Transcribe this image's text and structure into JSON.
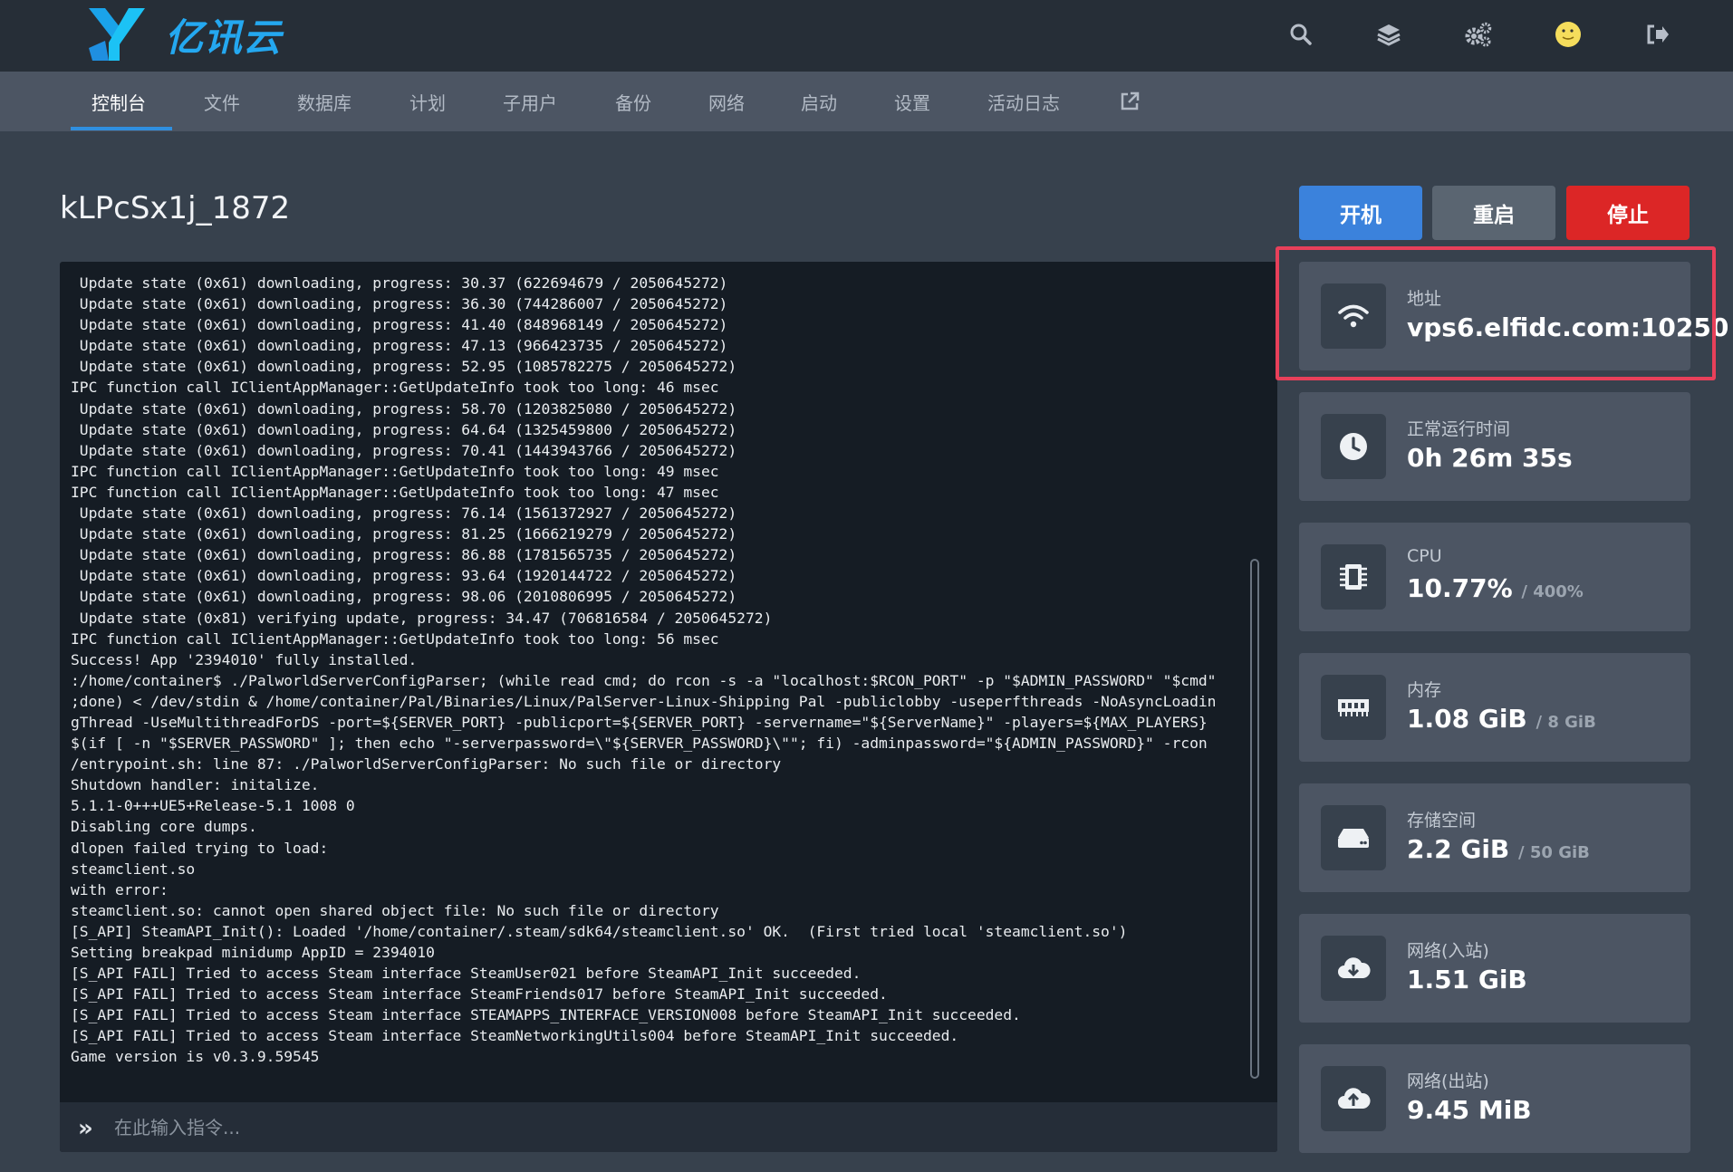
{
  "brand": {
    "name": "亿讯云"
  },
  "top_icons": [
    "search-icon",
    "layers-icon",
    "cogs-icon",
    "avatar",
    "sign-out-icon"
  ],
  "nav": {
    "tabs": [
      {
        "label": "控制台"
      },
      {
        "label": "文件"
      },
      {
        "label": "数据库"
      },
      {
        "label": "计划"
      },
      {
        "label": "子用户"
      },
      {
        "label": "备份"
      },
      {
        "label": "网络"
      },
      {
        "label": "启动"
      },
      {
        "label": "设置"
      },
      {
        "label": "活动日志"
      }
    ],
    "active_tab": "控制台",
    "external_link_icon": "external-link-icon"
  },
  "server": {
    "name": "kLPcSx1j_1872"
  },
  "power": {
    "start_label": "开机",
    "restart_label": "重启",
    "stop_label": "停止"
  },
  "console": {
    "lines": [
      " Update state (0x61) downloading, progress: 30.37 (622694679 / 2050645272)",
      " Update state (0x61) downloading, progress: 36.30 (744286007 / 2050645272)",
      " Update state (0x61) downloading, progress: 41.40 (848968149 / 2050645272)",
      " Update state (0x61) downloading, progress: 47.13 (966423735 / 2050645272)",
      " Update state (0x61) downloading, progress: 52.95 (1085782275 / 2050645272)",
      "IPC function call IClientAppManager::GetUpdateInfo took too long: 46 msec",
      " Update state (0x61) downloading, progress: 58.70 (1203825080 / 2050645272)",
      " Update state (0x61) downloading, progress: 64.64 (1325459800 / 2050645272)",
      " Update state (0x61) downloading, progress: 70.41 (1443943766 / 2050645272)",
      "IPC function call IClientAppManager::GetUpdateInfo took too long: 49 msec",
      "IPC function call IClientAppManager::GetUpdateInfo took too long: 47 msec",
      " Update state (0x61) downloading, progress: 76.14 (1561372927 / 2050645272)",
      " Update state (0x61) downloading, progress: 81.25 (1666219279 / 2050645272)",
      " Update state (0x61) downloading, progress: 86.88 (1781565735 / 2050645272)",
      " Update state (0x61) downloading, progress: 93.64 (1920144722 / 2050645272)",
      " Update state (0x61) downloading, progress: 98.06 (2010806995 / 2050645272)",
      " Update state (0x81) verifying update, progress: 34.47 (706816584 / 2050645272)",
      "IPC function call IClientAppManager::GetUpdateInfo took too long: 56 msec",
      "Success! App '2394010' fully installed.",
      ":/home/container$ ./PalworldServerConfigParser; (while read cmd; do rcon -s -a \"localhost:$RCON_PORT\" -p \"$ADMIN_PASSWORD\" \"$cmd\"",
      ";done) < /dev/stdin & /home/container/Pal/Binaries/Linux/PalServer-Linux-Shipping Pal -publiclobby -useperfthreads -NoAsyncLoadin",
      "gThread -UseMultithreadForDS -port=${SERVER_PORT} -publicport=${SERVER_PORT} -servername=\"${ServerName}\" -players=${MAX_PLAYERS}",
      "$(if [ -n \"$SERVER_PASSWORD\" ]; then echo \"-serverpassword=\\\"${SERVER_PASSWORD}\\\"\"; fi) -adminpassword=\"${ADMIN_PASSWORD}\" -rcon",
      "/entrypoint.sh: line 87: ./PalworldServerConfigParser: No such file or directory",
      "Shutdown handler: initalize.",
      "5.1.1-0+++UE5+Release-5.1 1008 0",
      "Disabling core dumps.",
      "dlopen failed trying to load:",
      "steamclient.so",
      "with error:",
      "steamclient.so: cannot open shared object file: No such file or directory",
      "[S_API] SteamAPI_Init(): Loaded '/home/container/.steam/sdk64/steamclient.so' OK.  (First tried local 'steamclient.so')",
      "Setting breakpad minidump AppID = 2394010",
      "[S_API FAIL] Tried to access Steam interface SteamUser021 before SteamAPI_Init succeeded.",
      "[S_API FAIL] Tried to access Steam interface SteamFriends017 before SteamAPI_Init succeeded.",
      "[S_API FAIL] Tried to access Steam interface STEAMAPPS_INTERFACE_VERSION008 before SteamAPI_Init succeeded.",
      "[S_API FAIL] Tried to access Steam interface SteamNetworkingUtils004 before SteamAPI_Init succeeded.",
      "Game version is v0.3.9.59545"
    ],
    "input_placeholder": "在此输入指令...",
    "prompt_icon": "chevron-double-right-icon"
  },
  "stats": {
    "address": {
      "label": "地址",
      "value": "vps6.elfidc.com:10250",
      "icon": "wifi-icon"
    },
    "uptime": {
      "label": "正常运行时间",
      "value": "0h 26m 35s",
      "icon": "clock-icon"
    },
    "cpu": {
      "label": "CPU",
      "value": "10.77%",
      "limit": "/ 400%",
      "icon": "microchip-icon"
    },
    "memory": {
      "label": "内存",
      "value": "1.08 GiB",
      "limit": "/ 8 GiB",
      "icon": "memory-icon"
    },
    "disk": {
      "label": "存储空间",
      "value": "2.2 GiB",
      "limit": "/ 50 GiB",
      "icon": "hdd-icon"
    },
    "net_in": {
      "label": "网络(入站)",
      "value": "1.51 GiB",
      "icon": "cloud-download-icon"
    },
    "net_out": {
      "label": "网络(出站)",
      "value": "9.45 MiB",
      "icon": "cloud-upload-icon"
    }
  },
  "colors": {
    "accent": "#3b82dc",
    "stop": "#dc2626",
    "restart": "#5a6571",
    "highlight": "#e8405a",
    "brand": "#24a8f0"
  }
}
